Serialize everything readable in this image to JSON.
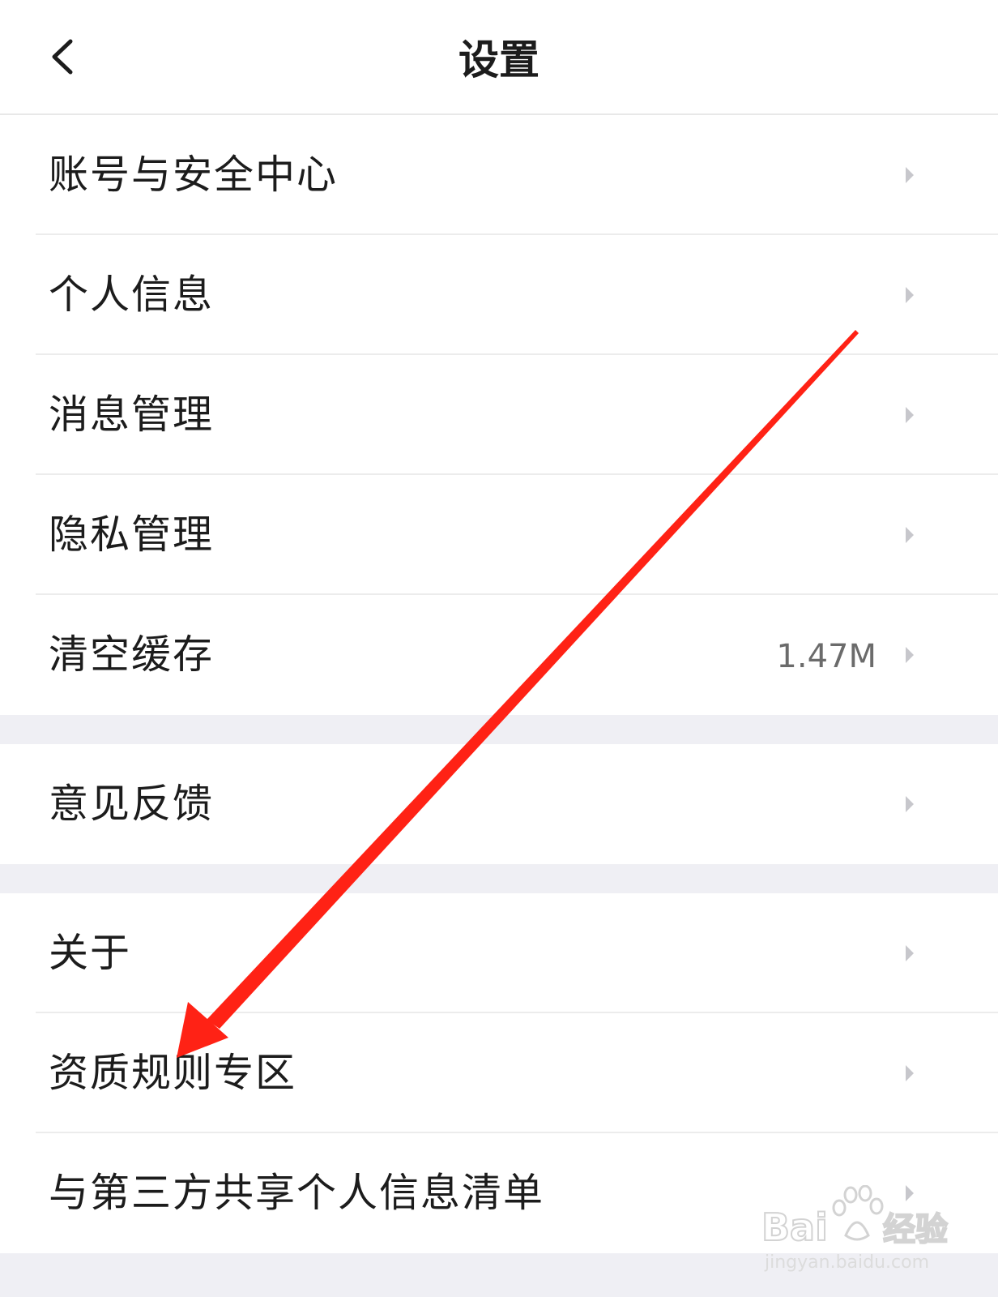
{
  "header": {
    "title": "设置",
    "back_icon": "chevron-left-icon"
  },
  "groups": [
    {
      "items": [
        {
          "label": "账号与安全中心",
          "value": ""
        },
        {
          "label": "个人信息",
          "value": ""
        },
        {
          "label": "消息管理",
          "value": ""
        },
        {
          "label": "隐私管理",
          "value": ""
        },
        {
          "label": "清空缓存",
          "value": "1.47M"
        }
      ]
    },
    {
      "items": [
        {
          "label": "意见反馈",
          "value": ""
        }
      ]
    },
    {
      "items": [
        {
          "label": "关于",
          "value": ""
        },
        {
          "label": "资质规则专区",
          "value": ""
        },
        {
          "label": "与第三方共享个人信息清单",
          "value": ""
        }
      ]
    }
  ],
  "annotation": {
    "arrow_color": "#ff2215",
    "points_to": "资质规则专区"
  },
  "watermark": {
    "brand": "Bai du 经验",
    "url": "jingyan.baidu.com"
  },
  "colors": {
    "background": "#ffffff",
    "group_gap": "#efeff4",
    "divider": "#ececec",
    "text_primary": "#1c1c1c",
    "text_secondary": "#6b6b6b",
    "chevron": "#c7c7cc"
  }
}
